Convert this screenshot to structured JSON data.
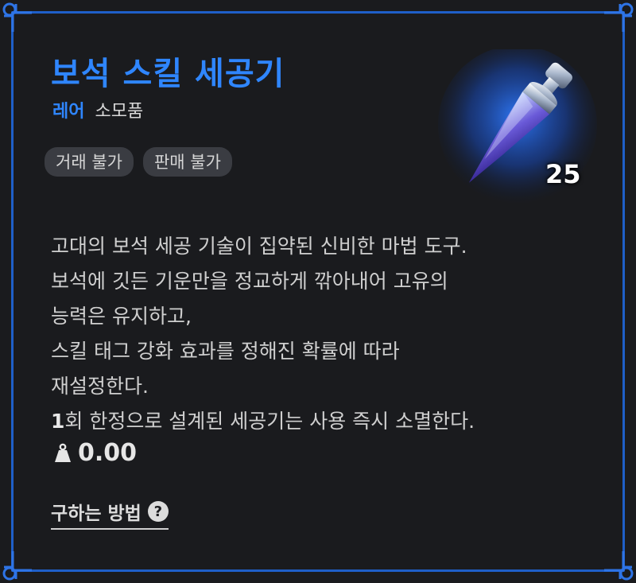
{
  "item": {
    "name": "보석 스킬 세공기",
    "grade": "레어",
    "category": "소모품",
    "tags": [
      "거래 불가",
      "판매 불가"
    ],
    "count": "25",
    "description": [
      "고대의 보석 세공 기술이 집약된 신비한 마법 도구.",
      "보석에 깃든 기운만을 정교하게 깎아내어 고유의",
      "능력은 유지하고,",
      "스킬 태그 강화 효과를 정해진 확률에 따라",
      "재설정한다."
    ],
    "limit_num": "1",
    "limit_rest": "회 한정으로 설계된 세공기는 사용 즉시 소멸한다.",
    "weight": "0.00",
    "acquire_label": "구하는 방법",
    "help_glyph": "?"
  },
  "icons": {
    "weight": "weight-icon",
    "help": "question-circle-icon",
    "item": "gem-chisel-icon",
    "corner": "ornament-corner-icon"
  },
  "colors": {
    "accent": "#2f86ff",
    "frame": "#1f5fc8",
    "background": "#1a1b1e",
    "tag_bg": "#3a3c42"
  }
}
